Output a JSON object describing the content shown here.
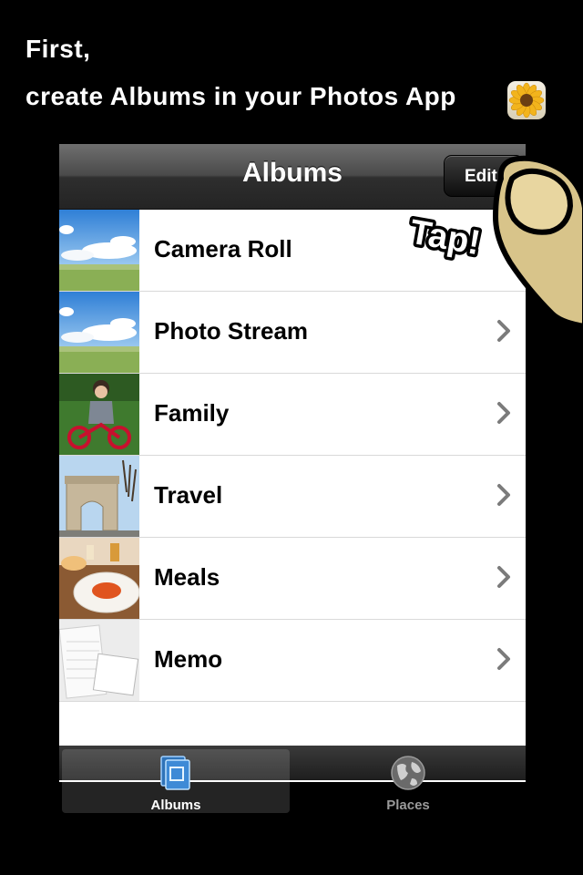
{
  "instruction": {
    "line1": "First,",
    "line2": "create Albums in your Photos App",
    "app_icon": "sunflower-icon"
  },
  "navbar": {
    "title": "Albums",
    "edit_label": "Edit"
  },
  "albums": [
    {
      "label": "Camera Roll",
      "thumb": "sky-field"
    },
    {
      "label": "Photo Stream",
      "thumb": "sky-field"
    },
    {
      "label": "Family",
      "thumb": "child-bike"
    },
    {
      "label": "Travel",
      "thumb": "arc-de-triomphe"
    },
    {
      "label": "Meals",
      "thumb": "meal-plate"
    },
    {
      "label": "Memo",
      "thumb": "notebook"
    }
  ],
  "tabbar": {
    "albums_label": "Albums",
    "places_label": "Places",
    "selected": "Albums"
  },
  "hint": {
    "tap_label": "Tap!"
  },
  "colors": {
    "background": "#000000",
    "accent_tab_icon": "#5aa7e6",
    "finger": "#d8c48a"
  }
}
